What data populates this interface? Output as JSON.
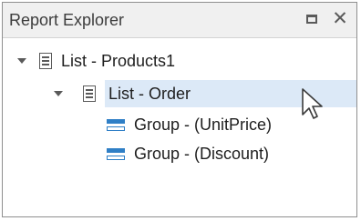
{
  "panel": {
    "title": "Report Explorer",
    "pin_icon": "pin-icon",
    "close_label": "✕"
  },
  "tree": {
    "items": [
      {
        "label": "List - Products1",
        "icon": "list-icon",
        "expanded": true,
        "level": 0
      },
      {
        "label": "List - Order",
        "icon": "list-icon",
        "expanded": true,
        "level": 1,
        "selected": true
      },
      {
        "label": "Group - (UnitPrice)",
        "icon": "group-icon",
        "level": 2
      },
      {
        "label": "Group - (Discount)",
        "icon": "group-icon",
        "level": 2
      }
    ]
  },
  "colors": {
    "selection": "#dce9f7",
    "group_icon": "#2f7fc6"
  }
}
